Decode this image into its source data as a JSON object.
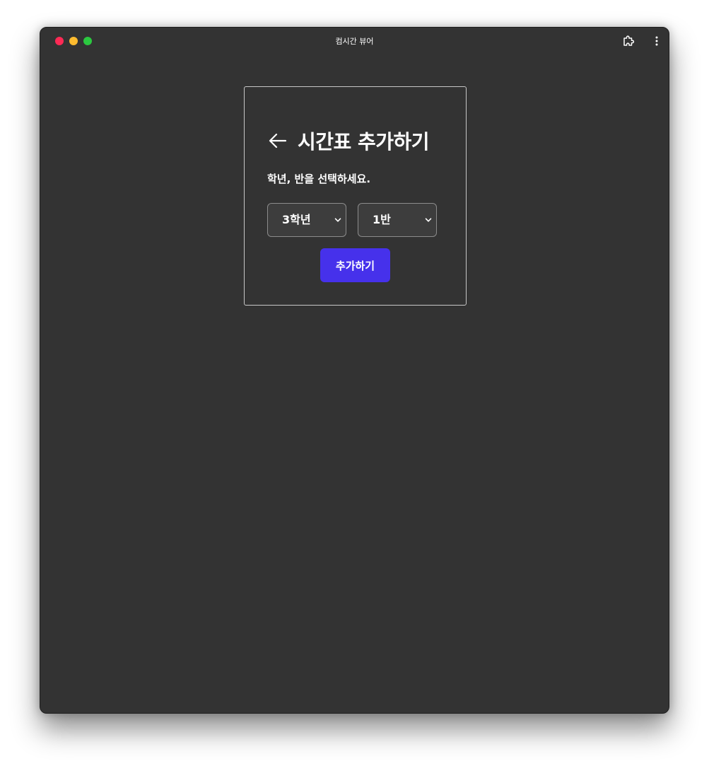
{
  "window": {
    "title": "컴시간 뷰어"
  },
  "page": {
    "title": "시간표 추가하기",
    "instruction": "학년, 반을 선택하세요.",
    "grade_select": {
      "selected": "3학년"
    },
    "class_select": {
      "selected": "1반"
    },
    "add_button_label": "추가하기"
  },
  "colors": {
    "background": "#333333",
    "accent": "#4631eb",
    "close": "#fe2a55",
    "minimize": "#fdbb2f",
    "maximize": "#2bc840"
  },
  "icons": [
    "extension-icon",
    "more-vert-icon",
    "arrow-left-icon",
    "chevron-down-icon"
  ]
}
